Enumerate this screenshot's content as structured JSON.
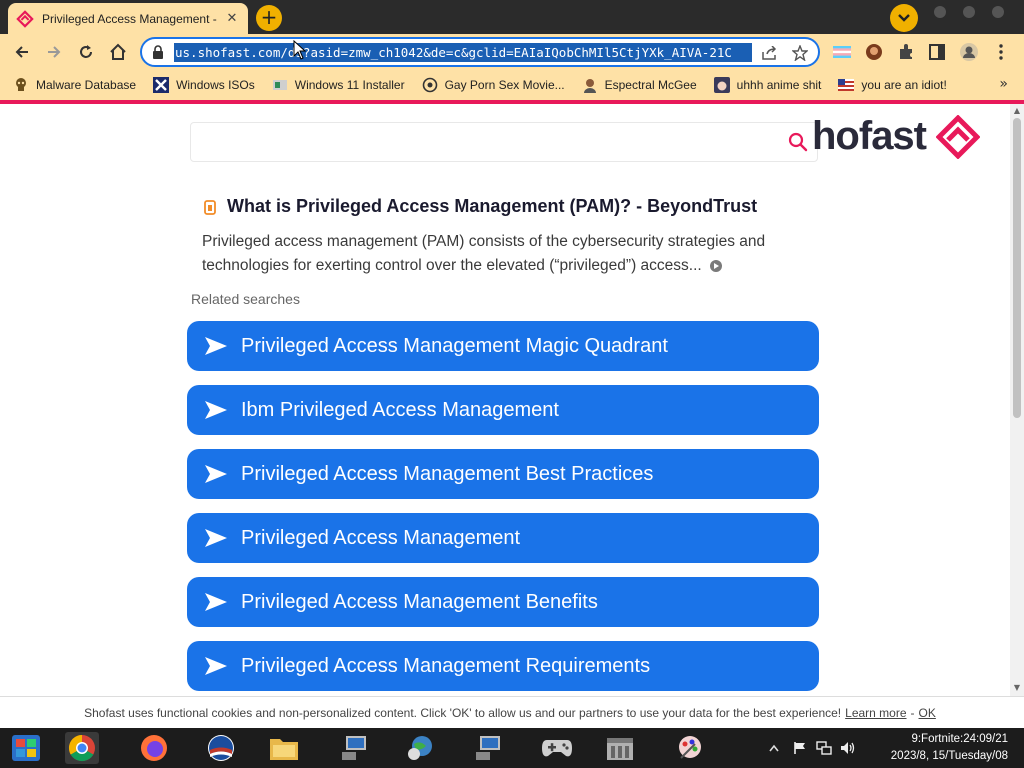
{
  "browser": {
    "tab": {
      "title": "Privileged Access Management - Sh",
      "close_glyph": "✕",
      "favicon": "shofast-logo-icon"
    },
    "new_tab_glyph": "+",
    "url": "us.shofast.com/ds?asid=zmw_ch1042&de=c&gclid=EAIaIQobChMIl5CtjYXk_AIVA-21C",
    "bookmarks": [
      {
        "label": "Malware Database",
        "icon": "skull-icon"
      },
      {
        "label": "Windows ISOs",
        "icon": "x-icon"
      },
      {
        "label": "Windows 11 Installer",
        "icon": "installer-icon"
      },
      {
        "label": "Gay Porn Sex Movie...",
        "icon": "gear-face-icon"
      },
      {
        "label": "Espectral McGee",
        "icon": "avatar-icon"
      },
      {
        "label": "uhhh anime shit",
        "icon": "anime-icon"
      },
      {
        "label": "you are an idiot!",
        "icon": "flag-icon"
      }
    ],
    "bookmarks_more": "»",
    "colors": {
      "theme": "#fee1a6",
      "accent": "#e8195a",
      "url_highlight": "#1a5fb4"
    }
  },
  "page": {
    "logo_text": "hofast",
    "result": {
      "title": "What is Privileged Access Management (PAM)? - BeyondTrust",
      "snippet": "Privileged access management (PAM) consists of the cybersecurity strategies and technologies for exerting control over the elevated (“privileged”) access..."
    },
    "related_label": "Related searches",
    "related": [
      "Privileged Access Management Magic Quadrant",
      "Ibm Privileged Access Management",
      "Privileged Access Management Best Practices",
      "Privileged Access Management",
      "Privileged Access Management Benefits",
      "Privileged Access Management Requirements"
    ],
    "colors": {
      "button": "#1a73e8"
    }
  },
  "cookie": {
    "text": "Shofast uses functional cookies and non-personalized content. Click 'OK' to allow us and our partners to use your data for the best experience!",
    "learn_more": "Learn more",
    "separator": "-",
    "ok": "OK"
  },
  "taskbar": {
    "clock_line1": "9:Fortnite:24:09/21",
    "clock_line2": "2023/8, 15/Tuesday/08"
  }
}
